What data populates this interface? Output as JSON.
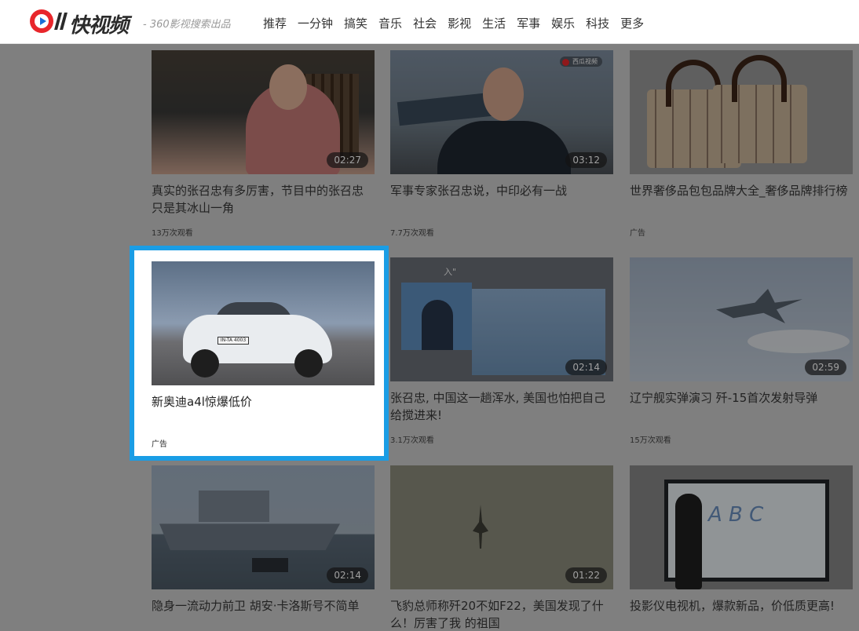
{
  "header": {
    "brand": "快视频",
    "tagline": "- 360影视搜索出品",
    "nav": [
      "推荐",
      "一分钟",
      "搞笑",
      "音乐",
      "社会",
      "影视",
      "生活",
      "军事",
      "娱乐",
      "科技",
      "更多"
    ]
  },
  "cards": [
    {
      "title": "真实的张召忠有多厉害，节目中的张召忠只是其冰山一角",
      "meta": "13万次观看",
      "duration": "02:27"
    },
    {
      "title": "军事专家张召忠说，中印必有一战",
      "meta": "7.7万次观看",
      "duration": "03:12",
      "source_badge": "西瓜视频"
    },
    {
      "title": "世界奢侈品包包品牌大全_奢侈品牌排行榜",
      "meta": "广告"
    },
    {
      "title": "新奥迪a4l惊爆低价",
      "meta": "广告",
      "plate": "IN-TA 4003"
    },
    {
      "title": "张召忠, 中国这一趟浑水, 美国也怕把自己给搅进来!",
      "meta": "3.1万次观看",
      "duration": "02:14",
      "caption": "入\""
    },
    {
      "title": "辽宁舰实弹演习 歼-15首次发射导弹",
      "meta": "15万次观看",
      "duration": "02:59"
    },
    {
      "title": "隐身一流动力前卫 胡安·卡洛斯号不简单",
      "meta": "",
      "duration": "02:14"
    },
    {
      "title": "飞豹总师称歼20不如F22，美国发现了什么！厉害了我 的祖国",
      "meta": "",
      "duration": "01:22"
    },
    {
      "title": "投影仪电视机，爆款新品，价低质更高!",
      "meta": "",
      "board_text": "A B C"
    }
  ],
  "colors": {
    "highlight_border": "#1a9de5",
    "logo_red": "#e8262b",
    "overlay": "#7f7f7f"
  }
}
